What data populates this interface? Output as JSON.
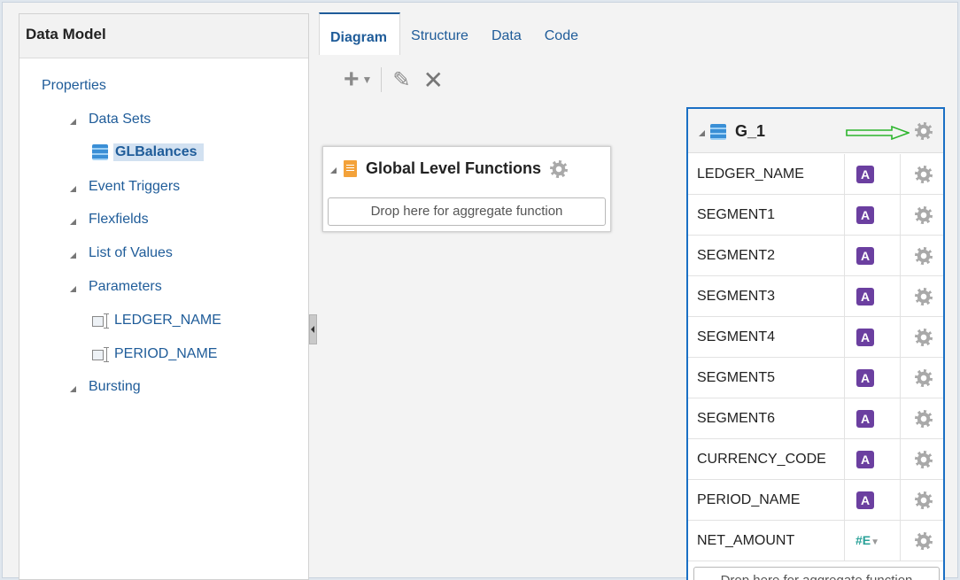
{
  "left_panel": {
    "title": "Data Model",
    "properties_label": "Properties",
    "tree": [
      {
        "label": "Data Sets"
      },
      {
        "label": "GLBalances"
      },
      {
        "label": "Event Triggers"
      },
      {
        "label": "Flexfields"
      },
      {
        "label": "List of Values"
      },
      {
        "label": "Parameters"
      },
      {
        "label": "LEDGER_NAME"
      },
      {
        "label": "PERIOD_NAME"
      },
      {
        "label": "Bursting"
      }
    ]
  },
  "tabs": [
    {
      "label": "Diagram",
      "active": true
    },
    {
      "label": "Structure"
    },
    {
      "label": "Data"
    },
    {
      "label": "Code"
    }
  ],
  "toolbar": {
    "add_icon": "plus-icon",
    "edit_icon": "pencil-icon",
    "delete_icon": "x-icon"
  },
  "global_functions": {
    "title": "Global Level Functions",
    "drop_placeholder": "Drop here for aggregate function"
  },
  "group": {
    "title": "G_1",
    "columns": [
      {
        "name": "LEDGER_NAME",
        "type": "A"
      },
      {
        "name": "SEGMENT1",
        "type": "A"
      },
      {
        "name": "SEGMENT2",
        "type": "A"
      },
      {
        "name": "SEGMENT3",
        "type": "A"
      },
      {
        "name": "SEGMENT4",
        "type": "A"
      },
      {
        "name": "SEGMENT5",
        "type": "A"
      },
      {
        "name": "SEGMENT6",
        "type": "A"
      },
      {
        "name": "CURRENCY_CODE",
        "type": "A"
      },
      {
        "name": "PERIOD_NAME",
        "type": "A"
      },
      {
        "name": "NET_AMOUNT",
        "type": "#E"
      }
    ],
    "drop_placeholder": "Drop here for aggregate function"
  },
  "colors": {
    "accent": "#1a6fc4",
    "link": "#1f5c99",
    "annotation_arrow": "#2db52d",
    "string_type": "#6b3fa0",
    "number_type": "#2aa198"
  }
}
